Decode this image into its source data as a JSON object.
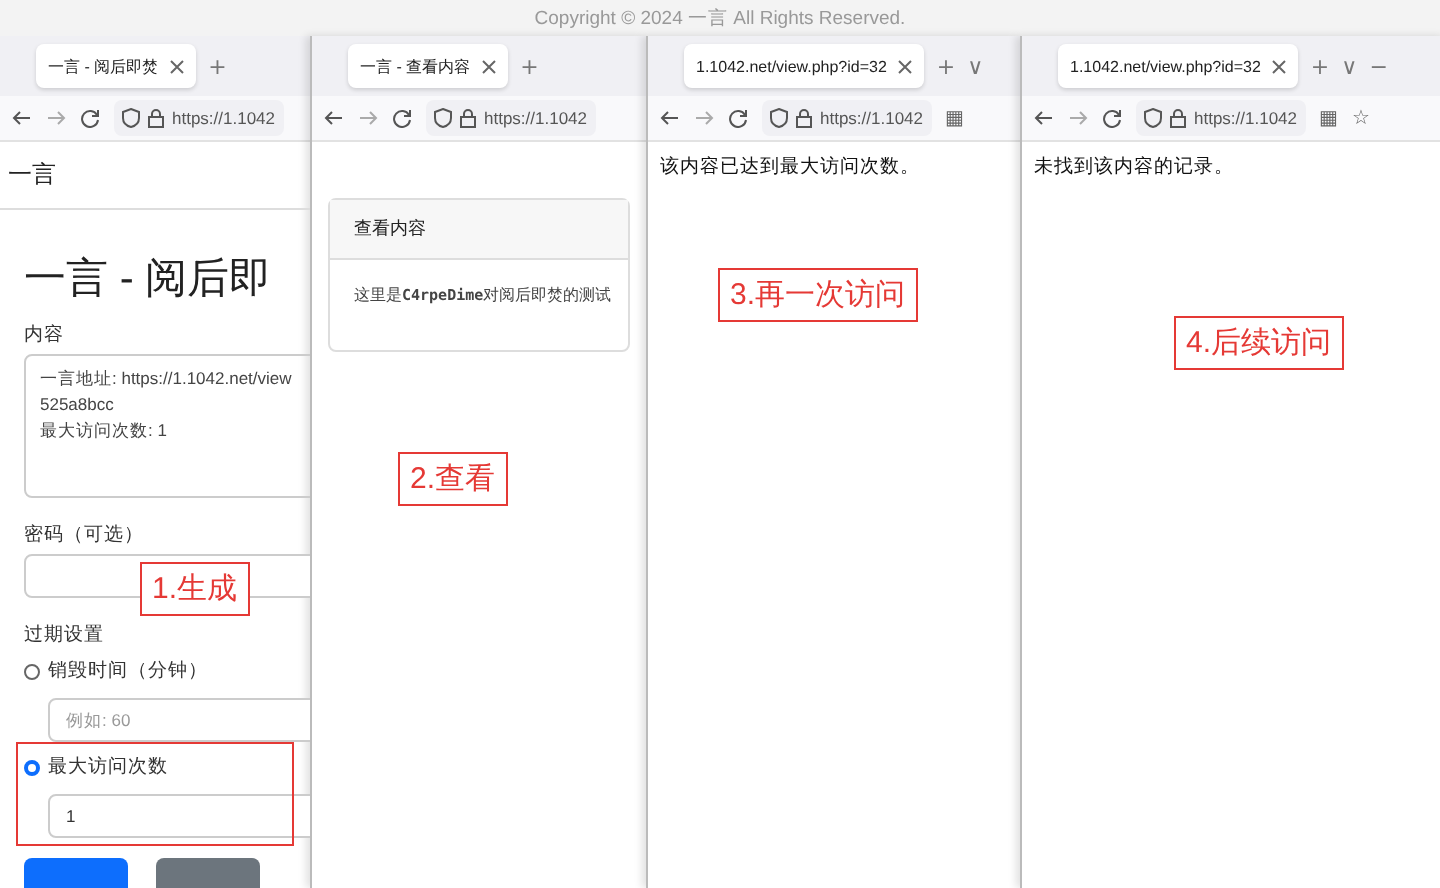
{
  "copyright": "Copyright © 2024 一言 All Rights Reserved.",
  "windows": [
    {
      "kind": "form",
      "tab": "一言 - 阅后即焚",
      "tab_buttons": [
        "+"
      ],
      "url": "https://1.1042",
      "site_title": "一言",
      "heading": "一言 - 阅后即",
      "content_label": "内容",
      "content_lines": [
        "一言地址: https://1.1042.net/view",
        "525a8bcc",
        "最大访问次数: 1"
      ],
      "password_label": "密码（可选）",
      "expiry_label": "过期设置",
      "expiry_options": [
        {
          "label": "销毁时间（分钟）",
          "selected": false,
          "highlighted": false,
          "placeholder": "例如: 60"
        },
        {
          "label": "最大访问次数",
          "selected": true,
          "highlighted": true,
          "value": "1"
        }
      ],
      "buttons": [
        {
          "kind": "primary"
        },
        {
          "kind": "secondary"
        }
      ],
      "annotation": "1.生成"
    },
    {
      "kind": "card",
      "tab": "一言 - 查看内容",
      "tab_buttons": [
        "+"
      ],
      "url": "https://1.1042",
      "card_title": "查看内容",
      "card_body": "这里是**C4rpeDime**对阅后即焚的测试",
      "annotation": "2.查看"
    },
    {
      "kind": "message",
      "tab": "1.1042.net/view.php?id=32",
      "tab_buttons": [
        "+",
        "∨"
      ],
      "url": "https://1.1042",
      "toolbar_extras": [
        "▦"
      ],
      "message": "该内容已达到最大访问次数。",
      "annotation": "3.再一次访问"
    },
    {
      "kind": "message",
      "tab": "1.1042.net/view.php?id=32",
      "tab_buttons": [
        "+",
        "∨",
        "−"
      ],
      "url": "https://1.1042",
      "toolbar_extras": [
        "▦",
        "☆"
      ],
      "message": "未找到该内容的记录。",
      "annotation": "4.后续访问"
    }
  ]
}
